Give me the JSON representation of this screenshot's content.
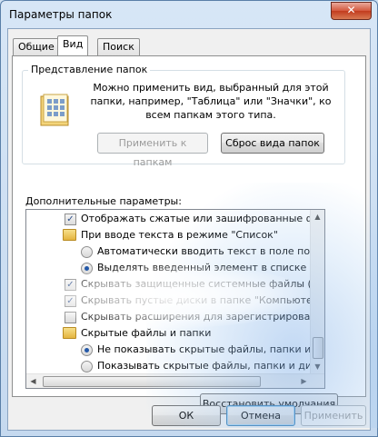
{
  "window": {
    "title": "Параметры папок",
    "close_glyph": "✕"
  },
  "tabs": [
    {
      "label": "Общие",
      "active": false
    },
    {
      "label": "Вид",
      "active": true
    },
    {
      "label": "Поиск",
      "active": false
    }
  ],
  "folder_view": {
    "group_title": "Представление папок",
    "description": "Можно применить вид, выбранный для этой папки, например, \"Таблица\" или \"Значки\", ко всем папкам этого типа.",
    "apply_button": "Применить к папкам",
    "reset_button": "Сброс вида папок",
    "icon": "folder-options-icon"
  },
  "advanced": {
    "label": "Дополнительные параметры:",
    "items": [
      {
        "kind": "checkbox",
        "checked": true,
        "indent": 0,
        "label": "Отображать сжатые или зашифрованные файлы NTI"
      },
      {
        "kind": "folder",
        "indent": 0,
        "label": "При вводе текста в режиме \"Список\""
      },
      {
        "kind": "radio",
        "checked": false,
        "indent": 1,
        "label": "Автоматически вводить текст в поле поиска"
      },
      {
        "kind": "radio",
        "checked": true,
        "indent": 1,
        "label": "Выделять введенный элемент в списке"
      },
      {
        "kind": "checkbox",
        "checked": true,
        "indent": 0,
        "label": "Скрывать защищенные системные файлы (рекомен"
      },
      {
        "kind": "checkbox",
        "checked": true,
        "indent": 0,
        "label": "Скрывать пустые диски в папке \"Компьютер\""
      },
      {
        "kind": "checkbox",
        "checked": false,
        "indent": 0,
        "label": "Скрывать расширения для зарегистрированных типо"
      },
      {
        "kind": "folder",
        "indent": 0,
        "label": "Скрытые файлы и папки"
      },
      {
        "kind": "radio",
        "checked": true,
        "indent": 1,
        "label": "Не показывать скрытые файлы, папки и диски"
      },
      {
        "kind": "radio",
        "checked": false,
        "indent": 1,
        "label": "Показывать скрытые файлы, папки и диски"
      }
    ]
  },
  "restore_button": "Восстановить умолчания",
  "footer": {
    "ok": "ОК",
    "cancel": "Отмена",
    "apply": "Применить"
  },
  "scroll_glyphs": {
    "up": "▲",
    "down": "▼",
    "left": "◀",
    "right": "▶"
  }
}
